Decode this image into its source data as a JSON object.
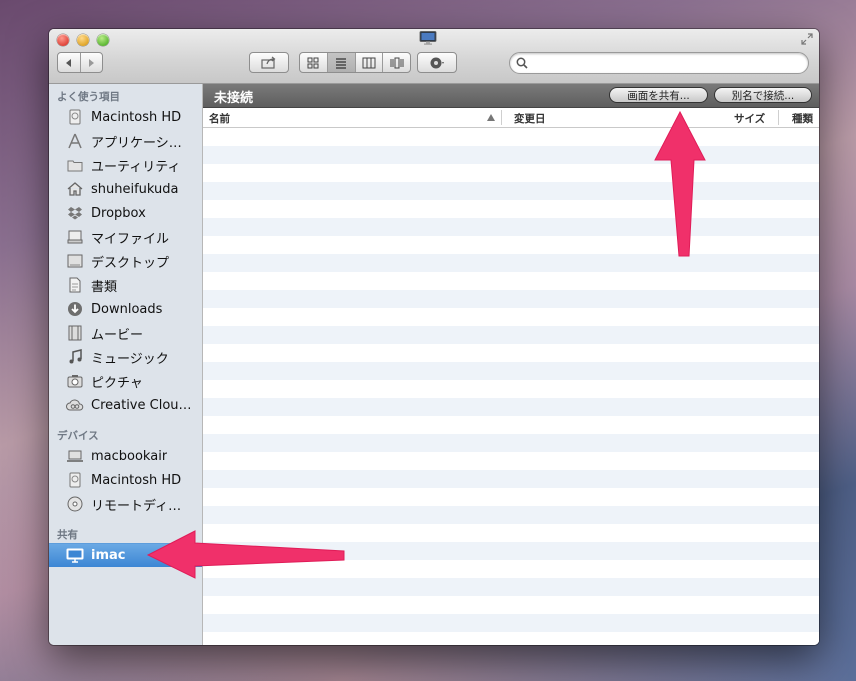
{
  "finder": {
    "search": {
      "value": "",
      "placeholder": ""
    },
    "sidebar": {
      "favorites_header": "よく使う項目",
      "favorites": [
        {
          "label": "Macintosh HD",
          "icon": "hard-drive-icon"
        },
        {
          "label": "アプリケーシ…",
          "icon": "applications-icon"
        },
        {
          "label": "ユーティリティ",
          "icon": "folder-icon"
        },
        {
          "label": "shuheifukuda",
          "icon": "home-icon"
        },
        {
          "label": "Dropbox",
          "icon": "dropbox-icon"
        },
        {
          "label": "マイファイル",
          "icon": "all-my-files-icon"
        },
        {
          "label": "デスクトップ",
          "icon": "desktop-icon"
        },
        {
          "label": "書類",
          "icon": "documents-icon"
        },
        {
          "label": "Downloads",
          "icon": "downloads-icon"
        },
        {
          "label": "ムービー",
          "icon": "movies-icon"
        },
        {
          "label": "ミュージック",
          "icon": "music-icon"
        },
        {
          "label": "ピクチャ",
          "icon": "camera-icon"
        },
        {
          "label": "Creative Clou…",
          "icon": "creative-cloud-icon"
        }
      ],
      "devices_header": "デバイス",
      "devices": [
        {
          "label": "macbookair",
          "icon": "laptop-icon"
        },
        {
          "label": "Macintosh HD",
          "icon": "hard-drive-icon"
        },
        {
          "label": "リモートディ…",
          "icon": "disc-icon"
        }
      ],
      "shared_header": "共有",
      "shared": [
        {
          "label": "imac",
          "icon": "imac-icon",
          "selected": true
        }
      ]
    },
    "pathbar": {
      "title": "未接続",
      "share_screen_button": "画面を共有...",
      "connect_as_button": "別名で接続..."
    },
    "columns": {
      "name": "名前",
      "modified": "変更日",
      "size": "サイズ",
      "kind": "種類"
    },
    "colors": {
      "accent_arrow": "#f0306a",
      "selection": "#3c86d4"
    }
  }
}
